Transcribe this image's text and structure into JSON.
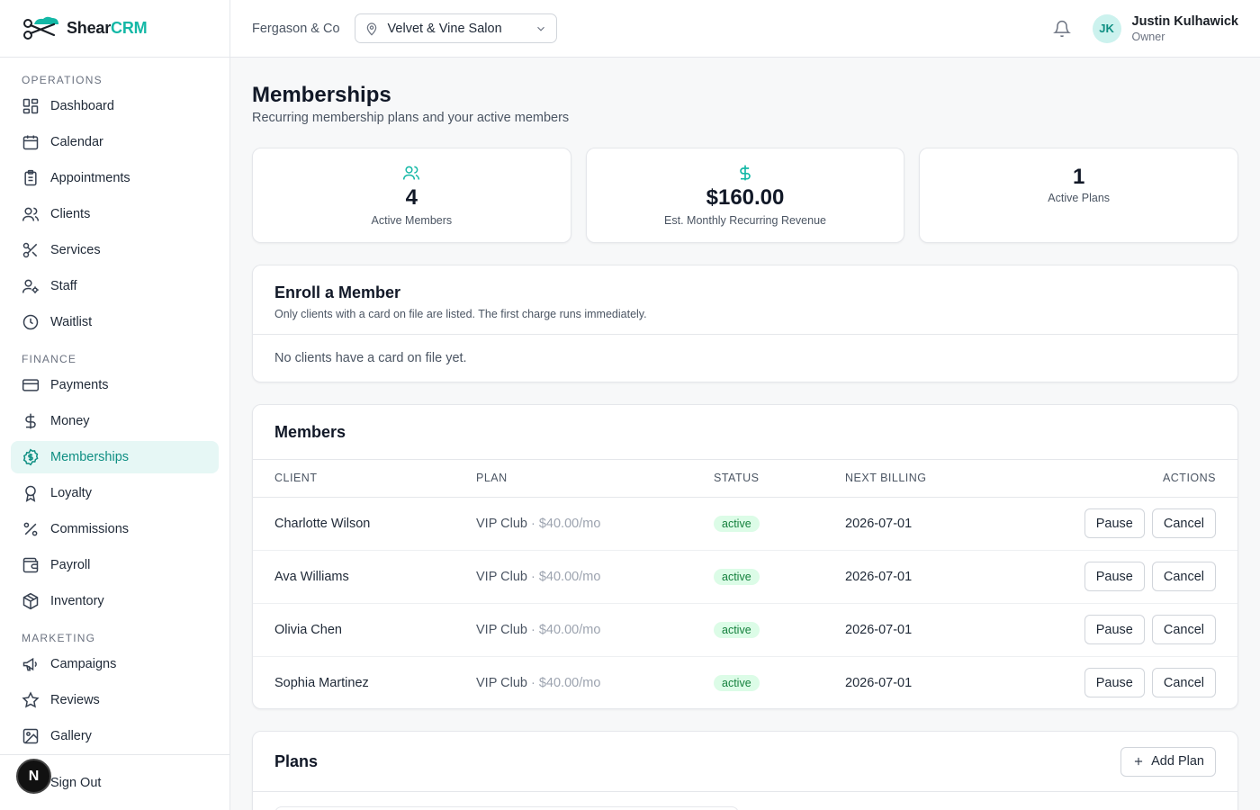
{
  "brand": {
    "prefix": "Shear",
    "accent": "CRM"
  },
  "sidebar": {
    "sections": [
      {
        "label": "OPERATIONS",
        "items": [
          {
            "label": "Dashboard",
            "icon": "dashboard-icon"
          },
          {
            "label": "Calendar",
            "icon": "calendar-icon"
          },
          {
            "label": "Appointments",
            "icon": "clipboard-icon"
          },
          {
            "label": "Clients",
            "icon": "users-icon"
          },
          {
            "label": "Services",
            "icon": "scissors-icon"
          },
          {
            "label": "Staff",
            "icon": "user-cog-icon"
          },
          {
            "label": "Waitlist",
            "icon": "clock-icon"
          }
        ]
      },
      {
        "label": "FINANCE",
        "items": [
          {
            "label": "Payments",
            "icon": "credit-card-icon"
          },
          {
            "label": "Money",
            "icon": "dollar-icon"
          },
          {
            "label": "Memberships",
            "icon": "badge-dollar-icon",
            "active": true
          },
          {
            "label": "Loyalty",
            "icon": "award-icon"
          },
          {
            "label": "Commissions",
            "icon": "percent-icon"
          },
          {
            "label": "Payroll",
            "icon": "wallet-icon"
          },
          {
            "label": "Inventory",
            "icon": "package-icon"
          }
        ]
      },
      {
        "label": "MARKETING",
        "items": [
          {
            "label": "Campaigns",
            "icon": "megaphone-icon"
          },
          {
            "label": "Reviews",
            "icon": "star-icon"
          },
          {
            "label": "Gallery",
            "icon": "image-icon"
          }
        ]
      }
    ],
    "sign_out": "Sign Out",
    "dev_badge": "N"
  },
  "topbar": {
    "org": "Fergason & Co",
    "location": "Velvet & Vine Salon",
    "user": {
      "initials": "JK",
      "name": "Justin Kulhawick",
      "role": "Owner"
    }
  },
  "page": {
    "title": "Memberships",
    "subtitle": "Recurring membership plans and your active members"
  },
  "stats": [
    {
      "value": "4",
      "label": "Active Members",
      "icon": "users-icon"
    },
    {
      "value": "$160.00",
      "label": "Est. Monthly Recurring Revenue",
      "icon": "dollar-icon"
    },
    {
      "value": "1",
      "label": "Active Plans",
      "icon": ""
    }
  ],
  "enroll": {
    "title": "Enroll a Member",
    "subtitle": "Only clients with a card on file are listed. The first charge runs immediately.",
    "empty": "No clients have a card on file yet."
  },
  "members": {
    "title": "Members",
    "columns": [
      "CLIENT",
      "PLAN",
      "STATUS",
      "NEXT BILLING",
      "ACTIONS"
    ],
    "pause_label": "Pause",
    "cancel_label": "Cancel",
    "rows": [
      {
        "client": "Charlotte Wilson",
        "plan": "VIP Club",
        "price": "· $40.00/mo",
        "status": "active",
        "next_billing": "2026-07-01"
      },
      {
        "client": "Ava Williams",
        "plan": "VIP Club",
        "price": "· $40.00/mo",
        "status": "active",
        "next_billing": "2026-07-01"
      },
      {
        "client": "Olivia Chen",
        "plan": "VIP Club",
        "price": "· $40.00/mo",
        "status": "active",
        "next_billing": "2026-07-01"
      },
      {
        "client": "Sophia Martinez",
        "plan": "VIP Club",
        "price": "· $40.00/mo",
        "status": "active",
        "next_billing": "2026-07-01"
      }
    ]
  },
  "plans": {
    "title": "Plans",
    "add_label": "Add Plan"
  },
  "colors": {
    "accent": "#14b8a6",
    "accent_dark": "#0f8f83",
    "active_bg": "#e6f7f5",
    "badge_bg": "#dcfce7",
    "badge_text": "#15803d"
  }
}
